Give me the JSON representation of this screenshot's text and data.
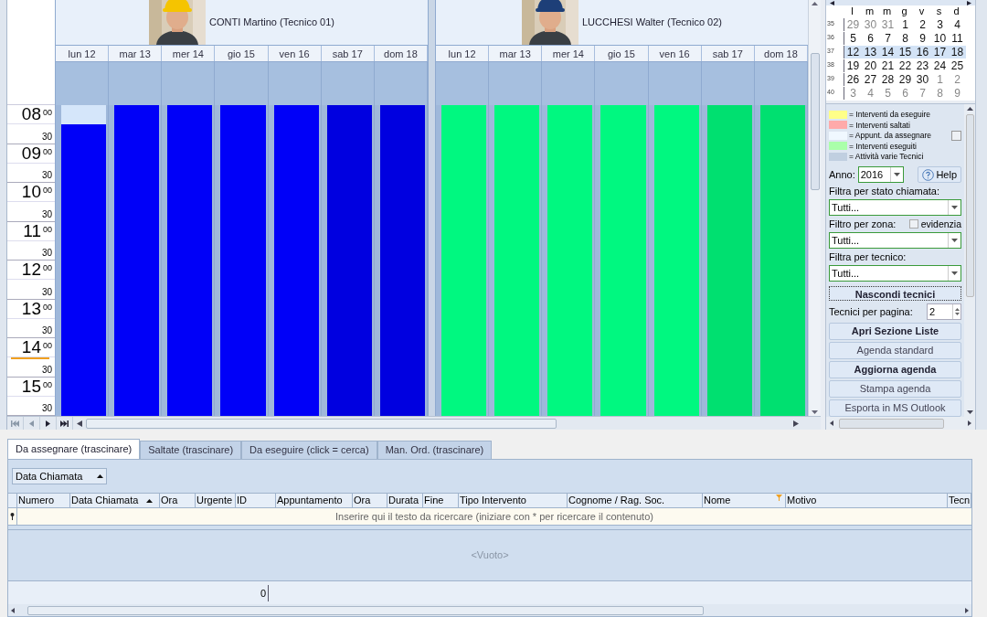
{
  "scheduler": {
    "hours": [
      {
        "hour": "08",
        "minutes": "00",
        "half": "30",
        "current": false
      },
      {
        "hour": "09",
        "minutes": "00",
        "half": "30",
        "current": false
      },
      {
        "hour": "10",
        "minutes": "00",
        "half": "30",
        "current": false
      },
      {
        "hour": "11",
        "minutes": "00",
        "half": "30",
        "current": false
      },
      {
        "hour": "12",
        "minutes": "00",
        "half": "30",
        "current": false
      },
      {
        "hour": "13",
        "minutes": "00",
        "half": "30",
        "current": false
      },
      {
        "hour": "14",
        "minutes": "00",
        "half": "30",
        "current": true
      },
      {
        "hour": "15",
        "minutes": "00",
        "half": "30",
        "current": false
      }
    ],
    "technicians": [
      {
        "name": "CONTI Martino (Tecnico 01)",
        "days": [
          {
            "label": "lun 12",
            "slot_selected": true,
            "color": "#0000f8"
          },
          {
            "label": "mar 13",
            "slot_selected": false,
            "color": "#0000f8"
          },
          {
            "label": "mer 14",
            "slot_selected": false,
            "color": "#0000f8"
          },
          {
            "label": "gio 15",
            "slot_selected": false,
            "color": "#0000f8"
          },
          {
            "label": "ven 16",
            "slot_selected": false,
            "color": "#0000f8"
          },
          {
            "label": "sab 17",
            "slot_selected": false,
            "color": "#0000e0"
          },
          {
            "label": "dom 18",
            "slot_selected": false,
            "color": "#0000e0"
          }
        ]
      },
      {
        "name": "LUCCHESI Walter (Tecnico 02)",
        "days": [
          {
            "label": "lun 12",
            "slot_selected": false,
            "color": "#00f880"
          },
          {
            "label": "mar 13",
            "slot_selected": false,
            "color": "#00f880"
          },
          {
            "label": "mer 14",
            "slot_selected": false,
            "color": "#00f880"
          },
          {
            "label": "gio 15",
            "slot_selected": false,
            "color": "#00f880"
          },
          {
            "label": "ven 16",
            "slot_selected": false,
            "color": "#00f880"
          },
          {
            "label": "sab 17",
            "slot_selected": false,
            "color": "#00e070"
          },
          {
            "label": "dom 18",
            "slot_selected": false,
            "color": "#00e070"
          }
        ]
      }
    ]
  },
  "calendar": {
    "weekdays": [
      "l",
      "m",
      "m",
      "g",
      "v",
      "s",
      "d"
    ],
    "weeks": [
      {
        "week": "35",
        "selected": false,
        "days": [
          {
            "day": "29",
            "kind": "other"
          },
          {
            "day": "30",
            "kind": "other"
          },
          {
            "day": "31",
            "kind": "other"
          },
          {
            "day": "1",
            "kind": "month"
          },
          {
            "day": "2",
            "kind": "month"
          },
          {
            "day": "3",
            "kind": "month"
          },
          {
            "day": "4",
            "kind": "month"
          }
        ]
      },
      {
        "week": "36",
        "selected": false,
        "days": [
          {
            "day": "5",
            "kind": "month"
          },
          {
            "day": "6",
            "kind": "month"
          },
          {
            "day": "7",
            "kind": "month"
          },
          {
            "day": "8",
            "kind": "month"
          },
          {
            "day": "9",
            "kind": "month"
          },
          {
            "day": "10",
            "kind": "month"
          },
          {
            "day": "11",
            "kind": "month"
          }
        ]
      },
      {
        "week": "37",
        "selected": true,
        "days": [
          {
            "day": "12",
            "kind": "month"
          },
          {
            "day": "13",
            "kind": "month"
          },
          {
            "day": "14",
            "kind": "month"
          },
          {
            "day": "15",
            "kind": "month"
          },
          {
            "day": "16",
            "kind": "month"
          },
          {
            "day": "17",
            "kind": "month"
          },
          {
            "day": "18",
            "kind": "month"
          }
        ]
      },
      {
        "week": "38",
        "selected": false,
        "days": [
          {
            "day": "19",
            "kind": "month"
          },
          {
            "day": "20",
            "kind": "month"
          },
          {
            "day": "21",
            "kind": "month"
          },
          {
            "day": "22",
            "kind": "month"
          },
          {
            "day": "23",
            "kind": "month"
          },
          {
            "day": "24",
            "kind": "month"
          },
          {
            "day": "25",
            "kind": "month"
          }
        ]
      },
      {
        "week": "39",
        "selected": false,
        "days": [
          {
            "day": "26",
            "kind": "month"
          },
          {
            "day": "27",
            "kind": "month"
          },
          {
            "day": "28",
            "kind": "month"
          },
          {
            "day": "29",
            "kind": "month"
          },
          {
            "day": "30",
            "kind": "month"
          },
          {
            "day": "1",
            "kind": "other"
          },
          {
            "day": "2",
            "kind": "other"
          }
        ]
      },
      {
        "week": "40",
        "selected": false,
        "days": [
          {
            "day": "3",
            "kind": "other"
          },
          {
            "day": "4",
            "kind": "other"
          },
          {
            "day": "5",
            "kind": "other"
          },
          {
            "day": "6",
            "kind": "other"
          },
          {
            "day": "7",
            "kind": "other"
          },
          {
            "day": "8",
            "kind": "other"
          },
          {
            "day": "9",
            "kind": "other"
          }
        ]
      }
    ]
  },
  "legend": {
    "items": [
      {
        "label": "= Interventi da eseguire",
        "color": "#ffff88"
      },
      {
        "label": "= Interventi saltati",
        "color": "#ffaaaa"
      },
      {
        "label": "= Appunt. da assegnare",
        "color": "#f0f8ff"
      },
      {
        "label": "= Interventi eseguiti",
        "color": "#aaffaa"
      },
      {
        "label": "= Attività varie Tecnici",
        "color": "#c0cfe0"
      }
    ],
    "checked": false
  },
  "filters": {
    "year_label": "Anno:",
    "year": "2016",
    "help": "Help",
    "status_label": "Filtra per stato chiamata:",
    "status": "Tutti...",
    "zone_label": "Filtro per zona:",
    "highlight_label": "evidenzia",
    "highlight_checked": false,
    "zone": "Tutti...",
    "tech_label": "Filtra per tecnico:",
    "tech": "Tutti...",
    "hide_button": "Nascondi tecnici",
    "per_page_label": "Tecnici per pagina:",
    "per_page": "2",
    "buttons": [
      {
        "label": "Apri Sezione Liste",
        "bold": true
      },
      {
        "label": "Agenda standard",
        "bold": false
      },
      {
        "label": "Aggiorna agenda",
        "bold": true
      },
      {
        "label": "Stampa agenda",
        "bold": false
      },
      {
        "label": "Esporta in MS Outlook",
        "bold": false
      }
    ]
  },
  "tabs": [
    {
      "label": "Da assegnare (trascinare)",
      "selected": true
    },
    {
      "label": "Saltate (trascinare)",
      "selected": false
    },
    {
      "label": "Da eseguire (click = cerca)",
      "selected": false
    },
    {
      "label": "Man. Ord. (trascinare)",
      "selected": false
    }
  ],
  "group_by": {
    "label": "Data Chiamata",
    "sorted": true
  },
  "grid": {
    "columns": [
      {
        "label": "Numero",
        "sorted": false,
        "filtered": false
      },
      {
        "label": "Data Chiamata",
        "sorted": true,
        "filtered": false
      },
      {
        "label": "Ora",
        "sorted": false,
        "filtered": false
      },
      {
        "label": "Urgente",
        "sorted": false,
        "filtered": false
      },
      {
        "label": "ID",
        "sorted": false,
        "filtered": false
      },
      {
        "label": "Appuntamento",
        "sorted": false,
        "filtered": false
      },
      {
        "label": "Ora",
        "sorted": false,
        "filtered": false
      },
      {
        "label": "Durata",
        "sorted": false,
        "filtered": false
      },
      {
        "label": "Fine",
        "sorted": false,
        "filtered": false
      },
      {
        "label": "Tipo Intervento",
        "sorted": false,
        "filtered": false
      },
      {
        "label": "Cognome / Rag. Soc.",
        "sorted": false,
        "filtered": false
      },
      {
        "label": "Nome",
        "sorted": false,
        "filtered": true
      },
      {
        "label": "Motivo",
        "sorted": false,
        "filtered": false
      },
      {
        "label": "Tecn",
        "sorted": false,
        "filtered": false
      }
    ],
    "search_placeholder": "Inserire qui il testo da ricercare (iniziare con * per ricercare il contenuto)",
    "empty": "<Vuoto>",
    "footer_count": "0"
  }
}
